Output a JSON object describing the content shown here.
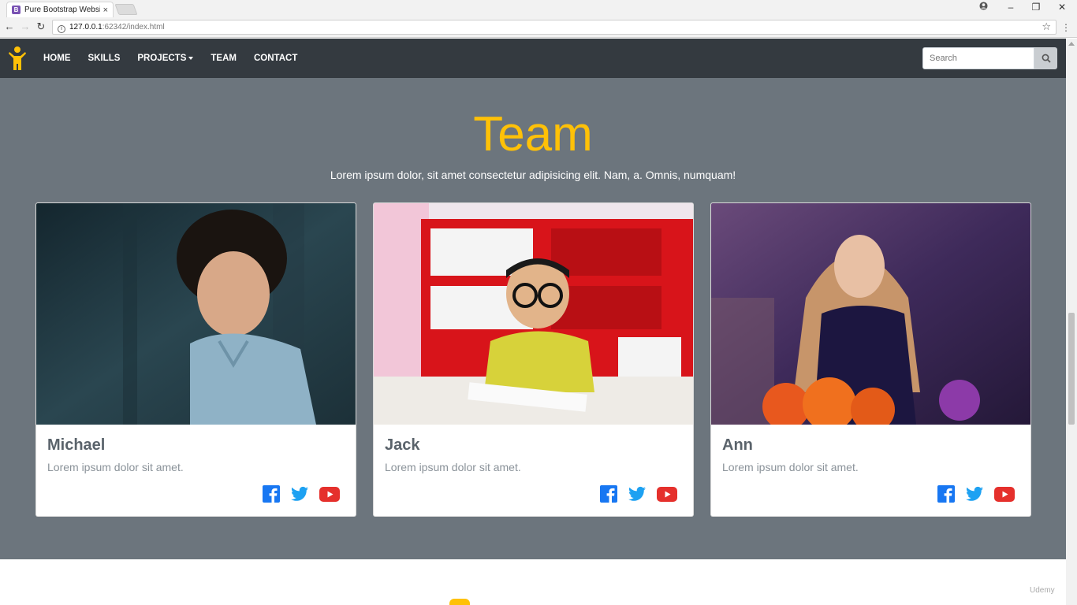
{
  "browser": {
    "tab_title": "Pure Bootstrap Website",
    "tab_favicon": "B",
    "tab_close": "×",
    "url_host": "127.0.0.1",
    "url_rest": ":62342/index.html"
  },
  "navbar": {
    "links": [
      "HOME",
      "SKILLS",
      "PROJECTS",
      "TEAM",
      "CONTACT"
    ],
    "search_placeholder": "Search"
  },
  "team": {
    "title": "Team",
    "lead": "Lorem ipsum dolor, sit amet consectetur adipisicing elit. Nam, a. Omnis, numquam!",
    "members": [
      {
        "name": "Michael",
        "text": "Lorem ipsum dolor sit amet."
      },
      {
        "name": "Jack",
        "text": "Lorem ipsum dolor sit amet."
      },
      {
        "name": "Ann",
        "text": "Lorem ipsum dolor sit amet."
      }
    ]
  },
  "watermark": "Udemy",
  "colors": {
    "accent": "#ffc107",
    "navbar_bg": "#343a40",
    "section_bg": "#6c757d",
    "facebook": "#1877f2",
    "twitter": "#1da1f2",
    "youtube": "#e5302c"
  }
}
